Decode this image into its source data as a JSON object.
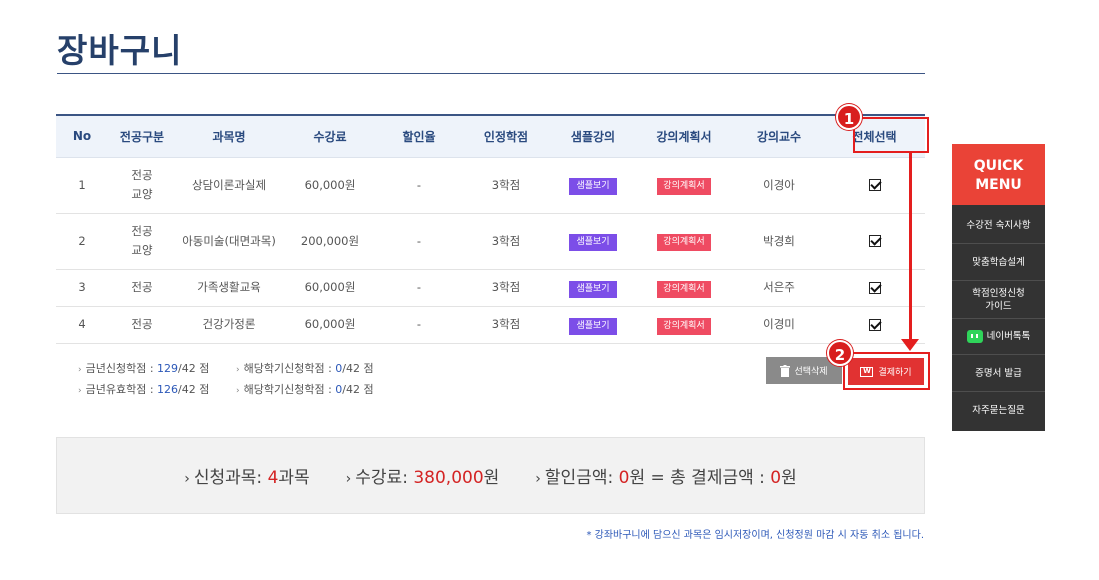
{
  "page": {
    "title": "장바구니"
  },
  "table": {
    "headers": [
      "No",
      "전공구분",
      "과목명",
      "수강료",
      "할인율",
      "인정학점",
      "샘플강의",
      "강의계획서",
      "강의교수",
      "전체선택"
    ],
    "rows": [
      {
        "no": "1",
        "type1": "전공",
        "type2": "교양",
        "course": "상담이론과실제",
        "fee": "60,000원",
        "discount": "-",
        "credit": "3학점",
        "sample": "샘플보기",
        "plan": "강의계획서",
        "professor": "이경아"
      },
      {
        "no": "2",
        "type1": "전공",
        "type2": "교양",
        "course": "아동미술(대면과목)",
        "fee": "200,000원",
        "discount": "-",
        "credit": "3학점",
        "sample": "샘플보기",
        "plan": "강의계획서",
        "professor": "박경희"
      },
      {
        "no": "3",
        "type1": "전공",
        "type2": "",
        "course": "가족생활교육",
        "fee": "60,000원",
        "discount": "-",
        "credit": "3학점",
        "sample": "샘플보기",
        "plan": "강의계획서",
        "professor": "서은주"
      },
      {
        "no": "4",
        "type1": "전공",
        "type2": "",
        "course": "건강가정론",
        "fee": "60,000원",
        "discount": "-",
        "credit": "3학점",
        "sample": "샘플보기",
        "plan": "강의계획서",
        "professor": "이경미"
      }
    ]
  },
  "credits": {
    "year_applied_label": "금년신청학점 :",
    "year_applied_value": "129",
    "year_applied_max": "/42 점",
    "term_applied_label": "해당학기신청학점 :",
    "term_applied_value": "0",
    "term_applied_max": "/42 점",
    "year_valid_label": "금년유효학점 :",
    "year_valid_value": "126",
    "year_valid_max": "/42 점",
    "term_pending_label": "해당학기신청학점 :",
    "term_pending_value": "0",
    "term_pending_max": "/42 점"
  },
  "actions": {
    "delete_label": "선택삭제",
    "pay_label": "결제하기"
  },
  "summary": {
    "courses_label": "신청과목:",
    "courses_value": "4",
    "courses_unit": "과목",
    "fee_label": "수강료:",
    "fee_value": "380,000",
    "fee_unit": "원",
    "discount_label": "할인금액:",
    "discount_value": "0",
    "discount_unit": "원",
    "equals_text": "= 총 결제금액 :",
    "total_value": "0",
    "total_unit": "원"
  },
  "footnote": "* 강좌바구니에 담으신 과목은 임시저장이며, 신청정원 마감 시 자동 취소 됩니다.",
  "quick_menu": {
    "title_line1": "QUICK",
    "title_line2": "MENU",
    "items": [
      "수강전 숙지사항",
      "맞춤학습설계",
      "학점인정신청",
      "가이드",
      "네이버톡톡",
      "증명서 발급",
      "자주묻는질문"
    ]
  },
  "annotations": {
    "badge1": "1",
    "badge2": "2"
  },
  "colors": {
    "accent_navy": "#26406a",
    "quick_red": "#ea4337",
    "pay_red": "#e13232",
    "sample_purple": "#7c4ee8",
    "plan_pink": "#ef4b62",
    "value_blue": "#2c58b8"
  }
}
